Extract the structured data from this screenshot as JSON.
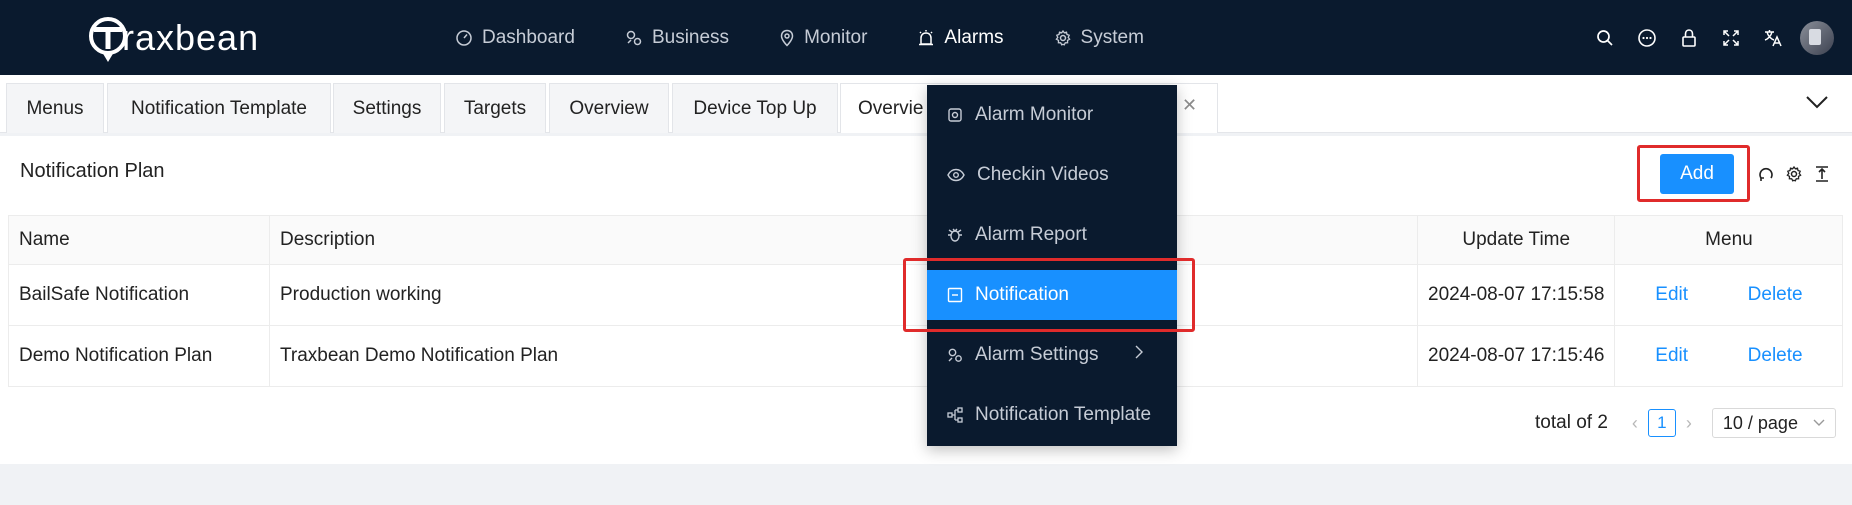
{
  "brand": {
    "name": "raxbean"
  },
  "nav": {
    "items": [
      {
        "label": "Dashboard",
        "icon": "gauge-icon"
      },
      {
        "label": "Business",
        "icon": "gears-icon"
      },
      {
        "label": "Monitor",
        "icon": "location-pin-icon"
      },
      {
        "label": "Alarms",
        "icon": "alarm-icon",
        "active": true
      },
      {
        "label": "System",
        "icon": "gear-icon"
      }
    ]
  },
  "header_icons": [
    "search-icon",
    "chat-icon",
    "lock-icon",
    "fullscreen-icon",
    "translate-icon",
    "avatar"
  ],
  "tabs": [
    {
      "label": "Menus"
    },
    {
      "label": "Notification Template"
    },
    {
      "label": "Settings"
    },
    {
      "label": "Targets"
    },
    {
      "label": "Overview"
    },
    {
      "label": "Device Top Up"
    },
    {
      "label": "Overvie"
    }
  ],
  "panel": {
    "title": "Notification Plan",
    "add_label": "Add"
  },
  "table": {
    "headers": {
      "name": "Name",
      "description": "Description",
      "update_time": "Update Time",
      "menu": "Menu"
    },
    "rows": [
      {
        "name": "BailSafe Notification",
        "description": "Production working",
        "update_time": "2024-08-07 17:15:58",
        "edit": "Edit",
        "delete": "Delete"
      },
      {
        "name": "Demo Notification Plan",
        "description": "Traxbean Demo Notification Plan",
        "update_time": "2024-08-07 17:15:46",
        "edit": "Edit",
        "delete": "Delete"
      }
    ]
  },
  "pagination": {
    "total": "total of 2",
    "current_page": "1",
    "page_size": "10 / page"
  },
  "dropdown": {
    "items": [
      {
        "label": "Alarm Monitor",
        "icon": "alarm-monitor-icon"
      },
      {
        "label": "Checkin Videos",
        "icon": "eye-icon"
      },
      {
        "label": "Alarm Report",
        "icon": "bug-icon"
      },
      {
        "label": "Notification",
        "icon": "notification-icon",
        "active": true
      },
      {
        "label": "Alarm Settings",
        "icon": "settings-gears-icon",
        "submenu": true
      },
      {
        "label": "Notification Template",
        "icon": "hierarchy-icon"
      }
    ]
  },
  "colors": {
    "topbar": "#0a1a2e",
    "accent": "#1890ff",
    "highlight": "#e02b2b"
  }
}
